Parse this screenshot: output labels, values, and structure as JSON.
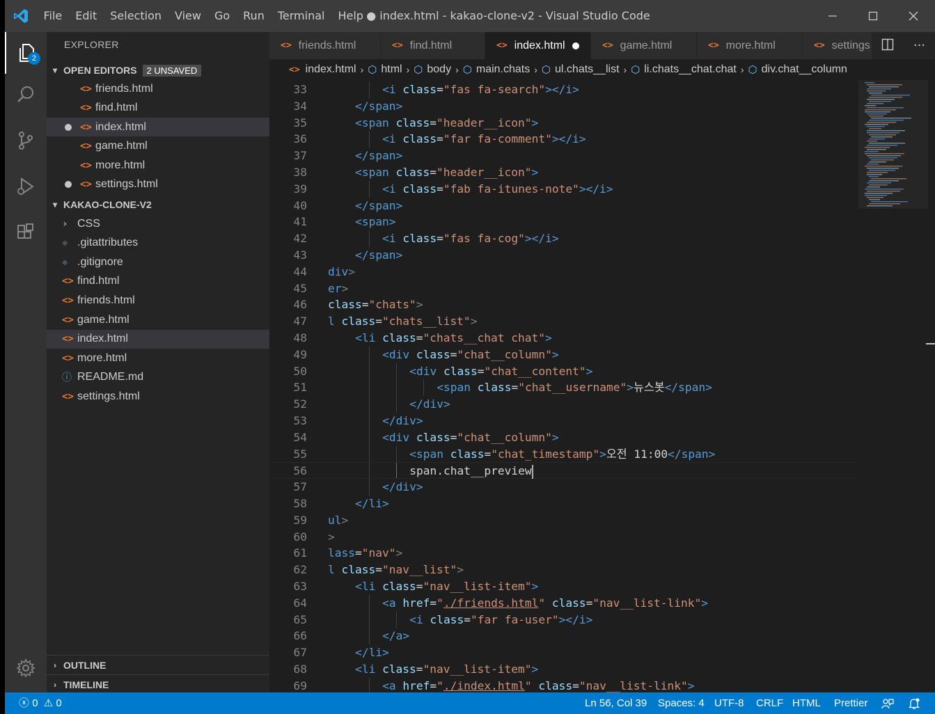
{
  "window": {
    "title": "● index.html - kakao-clone-v2 - Visual Studio Code",
    "menu": [
      "File",
      "Edit",
      "Selection",
      "View",
      "Go",
      "Run",
      "Terminal",
      "Help"
    ],
    "controls": {
      "minimize": "─",
      "maximize": "☐",
      "close": "✕"
    }
  },
  "activity_bar": {
    "explorer_badge": "2",
    "items": [
      "files-icon",
      "search-icon",
      "source-control-icon",
      "run-debug-icon",
      "extensions-icon"
    ],
    "bottom": "gear-icon"
  },
  "sidebar": {
    "title": "EXPLORER",
    "open_editors": {
      "label": "OPEN EDITORS",
      "badge": "2 UNSAVED",
      "files": [
        {
          "name": "friends.html",
          "dirty": false,
          "selected": false
        },
        {
          "name": "find.html",
          "dirty": false,
          "selected": false
        },
        {
          "name": "index.html",
          "dirty": true,
          "selected": true
        },
        {
          "name": "game.html",
          "dirty": false,
          "selected": false
        },
        {
          "name": "more.html",
          "dirty": false,
          "selected": false
        },
        {
          "name": "settings.html",
          "dirty": true,
          "selected": false
        }
      ]
    },
    "project": {
      "label": "KAKAO-CLONE-V2",
      "items": [
        {
          "name": "CSS",
          "kind": "folder",
          "selected": false
        },
        {
          "name": ".gitattributes",
          "kind": "git",
          "selected": false
        },
        {
          "name": ".gitignore",
          "kind": "git",
          "selected": false
        },
        {
          "name": "find.html",
          "kind": "html",
          "selected": false
        },
        {
          "name": "friends.html",
          "kind": "html",
          "selected": false
        },
        {
          "name": "game.html",
          "kind": "html",
          "selected": false
        },
        {
          "name": "index.html",
          "kind": "html",
          "selected": true
        },
        {
          "name": "more.html",
          "kind": "html",
          "selected": false
        },
        {
          "name": "README.md",
          "kind": "info",
          "selected": false
        },
        {
          "name": "settings.html",
          "kind": "html",
          "selected": false
        }
      ]
    },
    "outline_label": "OUTLINE",
    "timeline_label": "TIMELINE"
  },
  "tabs": [
    {
      "label": "friends.html",
      "active": false,
      "dirty": false
    },
    {
      "label": "find.html",
      "active": false,
      "dirty": false
    },
    {
      "label": "index.html",
      "active": true,
      "dirty": true
    },
    {
      "label": "game.html",
      "active": false,
      "dirty": false
    },
    {
      "label": "more.html",
      "active": false,
      "dirty": false
    },
    {
      "label": "settings",
      "active": false,
      "dirty": false
    }
  ],
  "breadcrumb": [
    "index.html",
    "html",
    "body",
    "main.chats",
    "ul.chats__list",
    "li.chats__chat.chat",
    "div.chat__column"
  ],
  "editor": {
    "current_line": 56,
    "lines": [
      {
        "n": "33",
        "ind": 2,
        "tokens": [
          [
            "tg",
            "<i "
          ],
          [
            "at",
            "class"
          ],
          [
            "tx",
            "="
          ],
          [
            "st",
            "\"fas fa-search\""
          ],
          [
            "tg",
            ">"
          ],
          [
            "tg",
            "</i>"
          ]
        ]
      },
      {
        "n": "34",
        "ind": 1,
        "tokens": [
          [
            "tg",
            "</span>"
          ]
        ]
      },
      {
        "n": "35",
        "ind": 1,
        "tokens": [
          [
            "tg",
            "<span "
          ],
          [
            "at",
            "class"
          ],
          [
            "tx",
            "="
          ],
          [
            "st",
            "\"header__icon\""
          ],
          [
            "tg",
            ">"
          ]
        ]
      },
      {
        "n": "36",
        "ind": 2,
        "tokens": [
          [
            "tg",
            "<i "
          ],
          [
            "at",
            "class"
          ],
          [
            "tx",
            "="
          ],
          [
            "st",
            "\"far fa-comment\""
          ],
          [
            "tg",
            ">"
          ],
          [
            "tg",
            "</i>"
          ]
        ]
      },
      {
        "n": "37",
        "ind": 1,
        "tokens": [
          [
            "tg",
            "</span>"
          ]
        ]
      },
      {
        "n": "38",
        "ind": 1,
        "tokens": [
          [
            "tg",
            "<span "
          ],
          [
            "at",
            "class"
          ],
          [
            "tx",
            "="
          ],
          [
            "st",
            "\"header__icon\""
          ],
          [
            "tg",
            ">"
          ]
        ]
      },
      {
        "n": "39",
        "ind": 2,
        "tokens": [
          [
            "tg",
            "<i "
          ],
          [
            "at",
            "class"
          ],
          [
            "tx",
            "="
          ],
          [
            "st",
            "\"fab fa-itunes-note\""
          ],
          [
            "tg",
            ">"
          ],
          [
            "tg",
            "</i>"
          ]
        ]
      },
      {
        "n": "40",
        "ind": 1,
        "tokens": [
          [
            "tg",
            "</span>"
          ]
        ]
      },
      {
        "n": "41",
        "ind": 1,
        "tokens": [
          [
            "tg",
            "<span>"
          ]
        ]
      },
      {
        "n": "42",
        "ind": 2,
        "tokens": [
          [
            "tg",
            "<i "
          ],
          [
            "at",
            "class"
          ],
          [
            "tx",
            "="
          ],
          [
            "st",
            "\"fas fa-cog\""
          ],
          [
            "tg",
            ">"
          ],
          [
            "tg",
            "</i>"
          ]
        ]
      },
      {
        "n": "43",
        "ind": 1,
        "tokens": [
          [
            "tg",
            "</span>"
          ]
        ]
      },
      {
        "n": "44",
        "ind": 0,
        "tokens": [
          [
            "tg",
            "div"
          ],
          [
            "pu",
            ">"
          ]
        ]
      },
      {
        "n": "45",
        "ind": 0,
        "tokens": [
          [
            "tg",
            "er"
          ],
          [
            "pu",
            ">"
          ]
        ]
      },
      {
        "n": "46",
        "ind": 0,
        "tokens": [
          [
            "at",
            "class"
          ],
          [
            "tx",
            "="
          ],
          [
            "st",
            "\"chats\""
          ],
          [
            "pu",
            ">"
          ]
        ]
      },
      {
        "n": "47",
        "ind": 0,
        "tokens": [
          [
            "tg",
            "l "
          ],
          [
            "at",
            "class"
          ],
          [
            "tx",
            "="
          ],
          [
            "st",
            "\"chats__list\""
          ],
          [
            "pu",
            ">"
          ]
        ]
      },
      {
        "n": "48",
        "ind": 1,
        "tokens": [
          [
            "tg",
            "<li "
          ],
          [
            "at",
            "class"
          ],
          [
            "tx",
            "="
          ],
          [
            "st",
            "\"chats__chat chat\""
          ],
          [
            "tg",
            ">"
          ]
        ]
      },
      {
        "n": "49",
        "ind": 2,
        "tokens": [
          [
            "tg",
            "<div "
          ],
          [
            "at",
            "class"
          ],
          [
            "tx",
            "="
          ],
          [
            "st",
            "\"chat__column\""
          ],
          [
            "tg",
            ">"
          ]
        ]
      },
      {
        "n": "50",
        "ind": 3,
        "tokens": [
          [
            "tg",
            "<div "
          ],
          [
            "at",
            "class"
          ],
          [
            "tx",
            "="
          ],
          [
            "st",
            "\"chat__content\""
          ],
          [
            "tg",
            ">"
          ]
        ]
      },
      {
        "n": "51",
        "ind": 4,
        "tokens": [
          [
            "tg",
            "<span "
          ],
          [
            "at",
            "class"
          ],
          [
            "tx",
            "="
          ],
          [
            "st",
            "\"chat__username\""
          ],
          [
            "tg",
            ">"
          ],
          [
            "tx",
            "뉴스봇"
          ],
          [
            "tg",
            "</span>"
          ]
        ]
      },
      {
        "n": "52",
        "ind": 3,
        "tokens": [
          [
            "tg",
            "</div>"
          ]
        ]
      },
      {
        "n": "53",
        "ind": 2,
        "tokens": [
          [
            "tg",
            "</div>"
          ]
        ]
      },
      {
        "n": "54",
        "ind": 2,
        "tokens": [
          [
            "tg",
            "<div "
          ],
          [
            "at",
            "class"
          ],
          [
            "tx",
            "="
          ],
          [
            "st",
            "\"chat__column\""
          ],
          [
            "tg",
            ">"
          ]
        ]
      },
      {
        "n": "55",
        "ind": 3,
        "tokens": [
          [
            "tg",
            "<span "
          ],
          [
            "at",
            "class"
          ],
          [
            "tx",
            "="
          ],
          [
            "st",
            "\"chat_timestamp\""
          ],
          [
            "tg",
            ">"
          ],
          [
            "tx",
            "오전 11:00"
          ],
          [
            "tg",
            "</span>"
          ]
        ]
      },
      {
        "n": "56",
        "ind": 3,
        "tokens": [
          [
            "tx",
            "span.chat__preview"
          ]
        ]
      },
      {
        "n": "57",
        "ind": 2,
        "tokens": [
          [
            "tg",
            "</div>"
          ]
        ]
      },
      {
        "n": "58",
        "ind": 1,
        "tokens": [
          [
            "tg",
            "</li>"
          ]
        ]
      },
      {
        "n": "59",
        "ind": 0,
        "tokens": [
          [
            "tg",
            "ul"
          ],
          [
            "pu",
            ">"
          ]
        ]
      },
      {
        "n": "60",
        "ind": 0,
        "tokens": [
          [
            "pu",
            ">"
          ]
        ]
      },
      {
        "n": "61",
        "ind": 0,
        "tokens": [
          [
            "tg",
            "lass"
          ],
          [
            "tx",
            "="
          ],
          [
            "st",
            "\"nav\""
          ],
          [
            "pu",
            ">"
          ]
        ]
      },
      {
        "n": "62",
        "ind": 0,
        "tokens": [
          [
            "tg",
            "l "
          ],
          [
            "at",
            "class"
          ],
          [
            "tx",
            "="
          ],
          [
            "st",
            "\"nav__list\""
          ],
          [
            "pu",
            ">"
          ]
        ]
      },
      {
        "n": "63",
        "ind": 1,
        "tokens": [
          [
            "tg",
            "<li "
          ],
          [
            "at",
            "class"
          ],
          [
            "tx",
            "="
          ],
          [
            "st",
            "\"nav__list-item\""
          ],
          [
            "tg",
            ">"
          ]
        ]
      },
      {
        "n": "64",
        "ind": 2,
        "tokens": [
          [
            "tg",
            "<a "
          ],
          [
            "at",
            "href"
          ],
          [
            "tx",
            "="
          ],
          [
            "st",
            "\""
          ],
          [
            "stu",
            "./friends.html"
          ],
          [
            "st",
            "\""
          ],
          [
            "tx",
            " "
          ],
          [
            "at",
            "class"
          ],
          [
            "tx",
            "="
          ],
          [
            "st",
            "\"nav__list-link\""
          ],
          [
            "tg",
            ">"
          ]
        ]
      },
      {
        "n": "65",
        "ind": 3,
        "tokens": [
          [
            "tg",
            "<i "
          ],
          [
            "at",
            "class"
          ],
          [
            "tx",
            "="
          ],
          [
            "st",
            "\"far fa-user\""
          ],
          [
            "tg",
            ">"
          ],
          [
            "tg",
            "</i>"
          ]
        ]
      },
      {
        "n": "66",
        "ind": 2,
        "tokens": [
          [
            "tg",
            "</a>"
          ]
        ]
      },
      {
        "n": "67",
        "ind": 1,
        "tokens": [
          [
            "tg",
            "</li>"
          ]
        ]
      },
      {
        "n": "68",
        "ind": 1,
        "tokens": [
          [
            "tg",
            "<li "
          ],
          [
            "at",
            "class"
          ],
          [
            "tx",
            "="
          ],
          [
            "st",
            "\"nav__list-item\""
          ],
          [
            "tg",
            ">"
          ]
        ]
      },
      {
        "n": "69",
        "ind": 2,
        "tokens": [
          [
            "tg",
            "<a "
          ],
          [
            "at",
            "href"
          ],
          [
            "tx",
            "="
          ],
          [
            "st",
            "\""
          ],
          [
            "stu",
            "./index.html"
          ],
          [
            "st",
            "\""
          ],
          [
            "tx",
            " "
          ],
          [
            "at",
            "class"
          ],
          [
            "tx",
            "="
          ],
          [
            "st",
            "\"nav__list-link\""
          ],
          [
            "tg",
            ">"
          ]
        ]
      }
    ]
  },
  "status_bar": {
    "errors": "0",
    "warnings": "0",
    "position": "Ln 56, Col 39",
    "spaces": "Spaces: 4",
    "encoding": "UTF-8",
    "eol": "CRLF",
    "language": "HTML",
    "formatter": "Prettier"
  },
  "colors": {
    "accent": "#007acc",
    "tag": "#569cd6",
    "attribute": "#9cdcfe",
    "string": "#ce9178",
    "html_icon": "#e37933"
  }
}
